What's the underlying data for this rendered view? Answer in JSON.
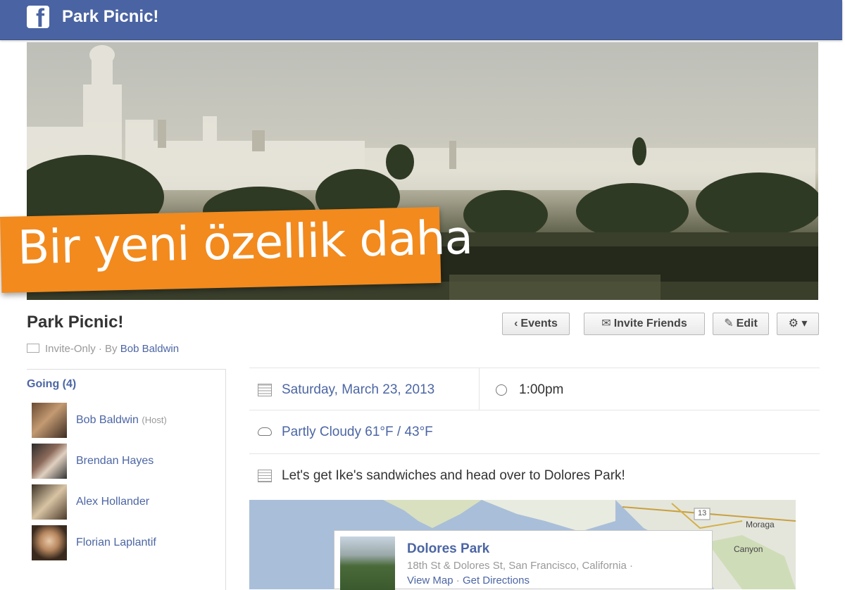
{
  "app": {
    "title": "Park Picnic!",
    "logo_letter": "f"
  },
  "banner": {
    "text": "Bir yeni özellik daha"
  },
  "event": {
    "title": "Park Picnic!",
    "privacy": "Invite-Only",
    "by_prefix": "· By",
    "host": "Bob Baldwin"
  },
  "actions": {
    "events": "Events",
    "invite": "Invite Friends",
    "edit": "Edit"
  },
  "going": {
    "label": "Going (4)",
    "people": [
      {
        "name": "Bob Baldwin",
        "tag": "(Host)"
      },
      {
        "name": "Brendan Hayes",
        "tag": ""
      },
      {
        "name": "Alex Hollander",
        "tag": ""
      },
      {
        "name": "Florian Laplantif",
        "tag": ""
      }
    ]
  },
  "details": {
    "date": "Saturday, March 23, 2013",
    "time": "1:00pm",
    "weather": "Partly Cloudy 61°F / 43°F",
    "description": "Let's get Ike's sandwiches and head over to Dolores Park!"
  },
  "place": {
    "name": "Dolores Park",
    "address": "18th St & Dolores St, San Francisco, California ·",
    "view_map": "View Map",
    "separator": "·",
    "get_directions": "Get Directions"
  },
  "map_labels": {
    "city1": "Moraga",
    "city2": "Canyon",
    "badge": "13"
  },
  "colors": {
    "brand": "#4a63a2",
    "banner": "#f28a1e",
    "link": "#4c66a4"
  }
}
